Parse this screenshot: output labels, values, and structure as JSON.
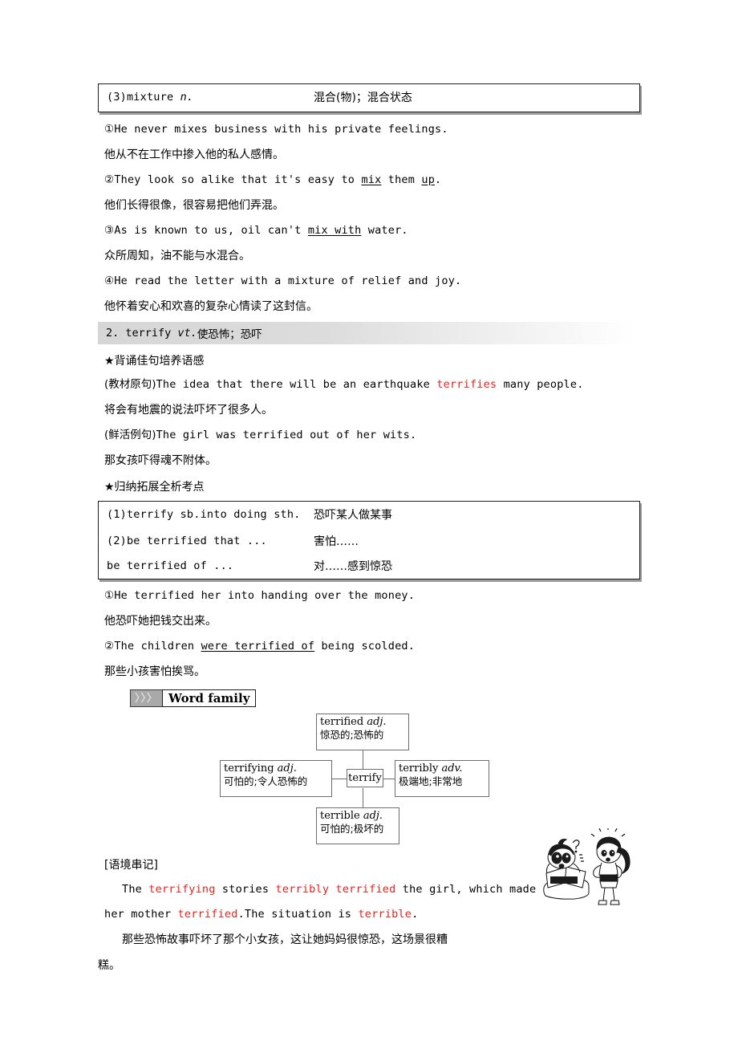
{
  "entry1": {
    "box": {
      "term": "(3)mixture ",
      "pos": "n.",
      "meaning": "混合(物)；混合状态"
    },
    "examples": [
      {
        "marker": "①",
        "pre": "He never mixes business with his private feelings.",
        "type": "en"
      },
      {
        "text": "他从不在工作中掺入他的私人感情。",
        "type": "zh"
      },
      {
        "marker": "②",
        "parts": [
          {
            "t": "They look so alike that it's easy to ",
            "u": false
          },
          {
            "t": "mix",
            "u": true
          },
          {
            "t": " them ",
            "u": false
          },
          {
            "t": "up",
            "u": true
          },
          {
            "t": ".",
            "u": false
          }
        ],
        "type": "en-parts"
      },
      {
        "text": "他们长得很像，很容易把他们弄混。",
        "type": "zh"
      },
      {
        "marker": "③",
        "parts": [
          {
            "t": "As is known to us, oil can't ",
            "u": false
          },
          {
            "t": "mix with",
            "u": true
          },
          {
            "t": " water.",
            "u": false
          }
        ],
        "type": "en-parts"
      },
      {
        "text": "众所周知，油不能与水混合。",
        "type": "zh"
      },
      {
        "marker": "④",
        "pre": "He read the letter with a mixture of relief and joy.",
        "type": "en"
      },
      {
        "text": "他怀着安心和欢喜的复杂心情读了这封信。",
        "type": "zh"
      }
    ]
  },
  "entry2": {
    "heading_num": "2. ",
    "heading_word": "terrify ",
    "heading_pos": "vt.",
    "heading_meaning": "使恐怖；恐吓",
    "star1": "★背诵佳句培养语感",
    "sentences": [
      {
        "label": "(教材原句)",
        "pre": "The idea that there will be an earthquake ",
        "hl": "terrifies",
        "post": " many people."
      },
      {
        "zh": "将会有地震的说法吓坏了很多人。"
      },
      {
        "label": "(鲜活例句)",
        "pre": "The girl was terrified out of her wits.",
        "hl": "",
        "post": ""
      },
      {
        "zh": "那女孩吓得魂不附体。"
      }
    ],
    "star2": "★归纳拓展全析考点",
    "usage_box": [
      {
        "en": "(1)terrify sb.into doing sth.",
        "zh": "恐吓某人做某事"
      },
      {
        "en": "(2)be terrified that ...",
        "zh": "害怕……"
      },
      {
        "en": "be terrified of ...",
        "zh": "对……感到惊恐"
      }
    ],
    "usage_examples": [
      {
        "marker": "①",
        "pre": "He terrified her into handing over the money.",
        "type": "en"
      },
      {
        "text": "他恐吓她把钱交出来。",
        "type": "zh"
      },
      {
        "marker": "②",
        "parts": [
          {
            "t": "The children ",
            "u": false
          },
          {
            "t": "were terrified of",
            "u": true
          },
          {
            "t": " being scolded.",
            "u": false
          }
        ],
        "type": "en-parts"
      },
      {
        "text": "那些小孩害怕挨骂。",
        "type": "zh"
      }
    ]
  },
  "word_family": {
    "badge_arrows": "〉〉〉",
    "badge_label": "Word family",
    "center": "terrify",
    "nodes": {
      "top": {
        "word": "terrified ",
        "pos": "adj.",
        "def": "惊恐的;恐怖的"
      },
      "left": {
        "word": "terrifying ",
        "pos": "adj.",
        "def": "可怕的;令人恐怖的"
      },
      "right": {
        "word": "terribly ",
        "pos": "adv.",
        "def": "极端地;非常地"
      },
      "bottom": {
        "word": "terrible ",
        "pos": "adj.",
        "def": "可怕的;极坏的"
      }
    }
  },
  "context": {
    "title": "[语境串记]",
    "line1": [
      {
        "t": "The ",
        "c": "k"
      },
      {
        "t": "terrifying",
        "c": "r"
      },
      {
        "t": " stories ",
        "c": "k"
      },
      {
        "t": "terribly terrified",
        "c": "r"
      },
      {
        "t": " the girl, which made",
        "c": "k"
      }
    ],
    "line2": [
      {
        "t": "her mother ",
        "c": "k"
      },
      {
        "t": "terrified",
        "c": "r"
      },
      {
        "t": ".The situation is ",
        "c": "k"
      },
      {
        "t": "terrible",
        "c": "r"
      },
      {
        "t": ".",
        "c": "k"
      }
    ],
    "zh_line1": "那些恐怖故事吓坏了那个小女孩，这让她妈妈很惊恐，这场景很糟",
    "zh_line2": "糕。",
    "illustration_alt": "scared-child-reading-horror-book-and-shocked-woman"
  },
  "colors": {
    "highlight_red": "#e8231c",
    "box_border": "#1c1c1c",
    "box_shadow": "#9b9b9b",
    "graybar_start": "#d6d6d6",
    "diagram_border": "#6e6e6e"
  }
}
